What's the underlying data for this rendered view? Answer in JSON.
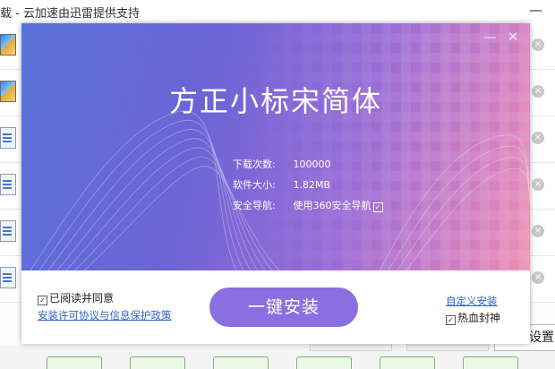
{
  "background_window": {
    "title": "载 - 云加速由迅雷提供支持",
    "minimize_glyph": "—",
    "rows": [
      {
        "icon": "package-icon",
        "close_glyph": "×"
      },
      {
        "icon": "package-icon",
        "close_glyph": "×"
      },
      {
        "icon": "document-icon",
        "close_glyph": "×"
      },
      {
        "icon": "document-icon",
        "close_glyph": "×"
      },
      {
        "icon": "document-icon",
        "close_glyph": "×"
      },
      {
        "icon": "document-icon",
        "close_glyph": "×"
      }
    ],
    "settings_label": "设置"
  },
  "dialog": {
    "minimize_glyph": "—",
    "close_glyph": "✕",
    "app_name": "方正小标宋简体",
    "info": {
      "downloads_label": "下载次数:",
      "downloads_value": "100000",
      "size_label": "软件大小:",
      "size_value": "1.82MB",
      "nav_label": "安全导航:",
      "nav_value": "使用360安全导航",
      "nav_checked": true
    },
    "footer": {
      "agree_label": "已阅读并同意",
      "agree_checked": true,
      "license_link": "安装许可协议与信息保护政策",
      "install_button": "一键安装",
      "custom_install_link": "自定义安装",
      "hot_blood_label": "热血封神",
      "hot_blood_checked": true
    }
  },
  "colors": {
    "hero_start": "#5a72dc",
    "hero_end": "#ee8fb3",
    "install_button": "#8a6fe0",
    "link": "#2f63c0"
  }
}
